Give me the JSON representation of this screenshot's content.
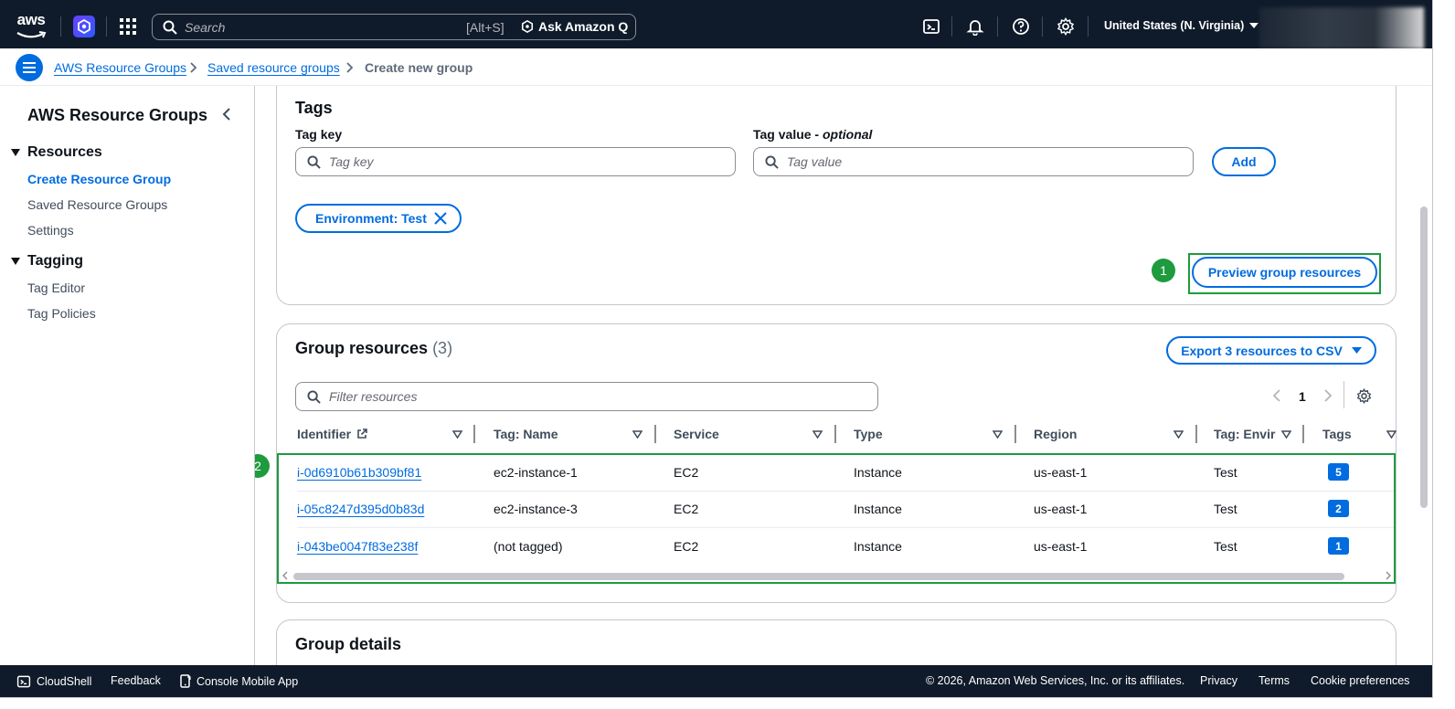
{
  "colors": {
    "nav_bg": "#0f1b2a",
    "link": "#006ce0",
    "highlight": "#1d9b3e",
    "text": "#0f141a"
  },
  "topnav": {
    "logo_text": "aws",
    "search_placeholder": "Search",
    "search_shortcut": "[Alt+S]",
    "ask_q_label": "Ask Amazon Q",
    "region_label": "United States (N. Virginia)"
  },
  "breadcrumb": {
    "items": [
      "AWS Resource Groups",
      "Saved resource groups",
      "Create new group"
    ]
  },
  "sidebar": {
    "title": "AWS Resource Groups",
    "sections": [
      {
        "label": "Resources",
        "items": [
          "Create Resource Group",
          "Saved Resource Groups",
          "Settings"
        ]
      },
      {
        "label": "Tagging",
        "items": [
          "Tag Editor",
          "Tag Policies"
        ]
      }
    ]
  },
  "tags_card": {
    "title": "Tags",
    "tag_key_label": "Tag key",
    "tag_key_placeholder": "Tag key",
    "tag_value_label": "Tag value - ",
    "tag_value_optional": "optional",
    "tag_value_placeholder": "Tag value",
    "add_label": "Add",
    "token_label": "Environment: Test",
    "preview_label": "Preview group resources",
    "step1": "1"
  },
  "group_resources": {
    "title": "Group resources",
    "count": "(3)",
    "export_label": "Export 3 resources to CSV",
    "filter_placeholder": "Filter resources",
    "page": "1",
    "step2": "2",
    "columns": [
      "Identifier",
      "Tag: Name",
      "Service",
      "Type",
      "Region",
      "Tag: Envir",
      "Tags"
    ],
    "rows": [
      {
        "identifier": "i-0d6910b61b309bf81",
        "name": "ec2-instance-1",
        "service": "EC2",
        "type": "Instance",
        "region": "us-east-1",
        "env": "Test",
        "tags": "5"
      },
      {
        "identifier": "i-05c8247d395d0b83d",
        "name": "ec2-instance-3",
        "service": "EC2",
        "type": "Instance",
        "region": "us-east-1",
        "env": "Test",
        "tags": "2"
      },
      {
        "identifier": "i-043be0047f83e238f",
        "name": "(not tagged)",
        "service": "EC2",
        "type": "Instance",
        "region": "us-east-1",
        "env": "Test",
        "tags": "1"
      }
    ]
  },
  "group_details": {
    "title": "Group details"
  },
  "footer": {
    "cloudshell": "CloudShell",
    "feedback": "Feedback",
    "mobile_app": "Console Mobile App",
    "copyright": "© 2026, Amazon Web Services, Inc. or its affiliates.",
    "privacy": "Privacy",
    "terms": "Terms",
    "cookies": "Cookie preferences"
  }
}
